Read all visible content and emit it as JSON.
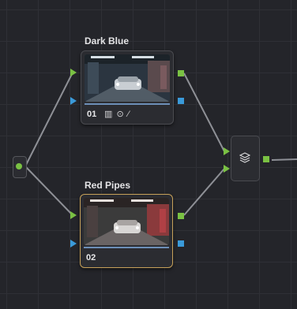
{
  "nodes": [
    {
      "label": "Dark Blue",
      "number": "01",
      "tools": "▥ ⊙ ⁄"
    },
    {
      "label": "Red Pipes",
      "number": "02"
    }
  ],
  "layer_mixer": {
    "icon": "layers-icon"
  },
  "input": {
    "icon": "source-input-dot"
  },
  "colors": {
    "green_port": "#7ac143",
    "blue_port": "#3a9ad9",
    "selected_border": "#c6a15a",
    "wire": "#8e9096"
  }
}
